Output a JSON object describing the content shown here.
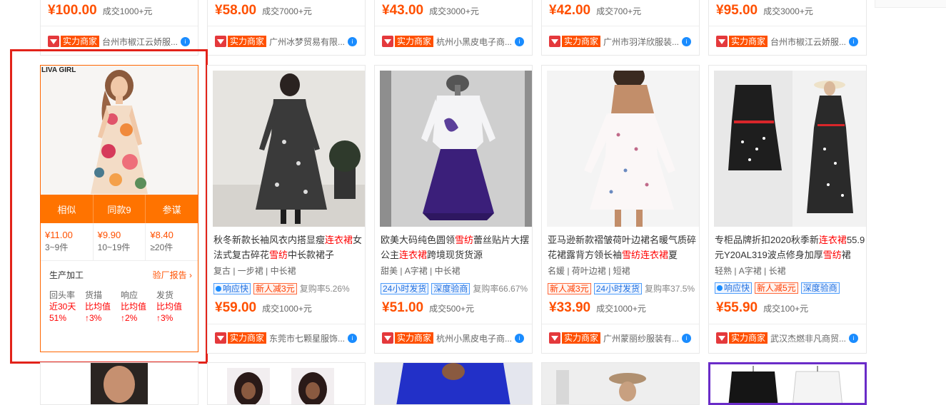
{
  "top_cards": [
    {
      "price": "¥100.00",
      "sold": "成交1000+元",
      "badge": "实力商家",
      "seller": "台州市椒江云娇服..."
    },
    {
      "price": "¥58.00",
      "sold": "成交7000+元",
      "badge": "实力商家",
      "seller": "广州冰梦贸易有限..."
    },
    {
      "price": "¥43.00",
      "sold": "成交3000+元",
      "badge": "实力商家",
      "seller": "杭州小黑皮电子商..."
    },
    {
      "price": "¥42.00",
      "sold": "成交700+元",
      "badge": "实力商家",
      "seller": "广州市羽洋欣服装..."
    },
    {
      "price": "¥95.00",
      "sold": "成交3000+元",
      "badge": "实力商家",
      "seller": "台州市椒江云娇服..."
    }
  ],
  "featured": {
    "brand_label": "LIVA GIRL",
    "actions": [
      "相似",
      "同款9",
      "参谋"
    ],
    "tiers": [
      {
        "price": "¥11.00",
        "qty": "3~9件"
      },
      {
        "price": "¥9.90",
        "qty": "10~19件"
      },
      {
        "price": "¥8.40",
        "qty": "≥20件"
      }
    ],
    "production": "生产加工",
    "report": "验厂报告",
    "stats": [
      {
        "head": "回头率",
        "v1": "近30天",
        "v2": "51%"
      },
      {
        "head": "货描",
        "v1": "比均值",
        "v2": "↑3%"
      },
      {
        "head": "响应",
        "v1": "比均值",
        "v2": "↑2%"
      },
      {
        "head": "发货",
        "v1": "比均值",
        "v2": "↑3%"
      }
    ]
  },
  "products": [
    {
      "title_parts": [
        "秋冬新款长袖风衣内搭显瘦",
        "连衣裙",
        "女法式复古碎花",
        "雪纺",
        "中长款裙子"
      ],
      "tags": "复古 | 一步裙 | 中长裙",
      "badges": [
        {
          "text": "响应快",
          "color": "blue",
          "dot": true
        },
        {
          "text": "新人减3元",
          "color": "red",
          "dot": false
        }
      ],
      "rebuy": "复购率5.26%",
      "price": "¥59.00",
      "sold": "成交1000+元",
      "badge": "实力商家",
      "seller": "东莞市七颗星服饰..."
    },
    {
      "title_parts": [
        "欧美大码纯色圆领",
        "雪纺",
        "蕾丝贴片大摆公主",
        "连衣裙",
        "跨境现货货源",
        "",
        ""
      ],
      "tags": "甜美 | A字裙 | 中长裙",
      "badges": [
        {
          "text": "24小时发货",
          "color": "blue",
          "dot": false
        },
        {
          "text": "深度验商",
          "color": "blue",
          "dot": false
        }
      ],
      "rebuy": "复购率66.67%",
      "price": "¥51.00",
      "sold": "成交500+元",
      "badge": "实力商家",
      "seller": "杭州小黑皮电子商..."
    },
    {
      "title_parts": [
        "亚马逊新款褶皱荷叶边裙名暖气质碎花裙露背方领长袖",
        "雪纺",
        "",
        "连衣裙",
        "夏"
      ],
      "tags": "名媛 | 荷叶边裙 | 短裙",
      "badges": [
        {
          "text": "新人减3元",
          "color": "red",
          "dot": false
        },
        {
          "text": "24小时发货",
          "color": "blue",
          "dot": false
        }
      ],
      "rebuy": "复购率37.5%",
      "price": "¥33.90",
      "sold": "成交1000+元",
      "badge": "实力商家",
      "seller": "广州蒙丽纱服装有..."
    },
    {
      "title_parts": [
        "专柜品牌折扣2020秋季新",
        "连衣裙",
        "55.9元Y20AL319波点修身加厚",
        "雪纺",
        "裙"
      ],
      "tags": "轻熟 | A字裙 | 长裙",
      "badges": [
        {
          "text": "响应快",
          "color": "blue",
          "dot": true
        },
        {
          "text": "新人减5元",
          "color": "red",
          "dot": false
        },
        {
          "text": "深度验商",
          "color": "blue",
          "dot": false
        }
      ],
      "rebuy": "",
      "price": "¥55.90",
      "sold": "成交100+元",
      "badge": "实力商家",
      "seller": "武汉杰燃非凡商贸..."
    }
  ],
  "colors": {
    "accent": "#ff5000",
    "highlight": "#ff0000",
    "action_bar": "#ff7300",
    "frame": "#e2231a"
  }
}
